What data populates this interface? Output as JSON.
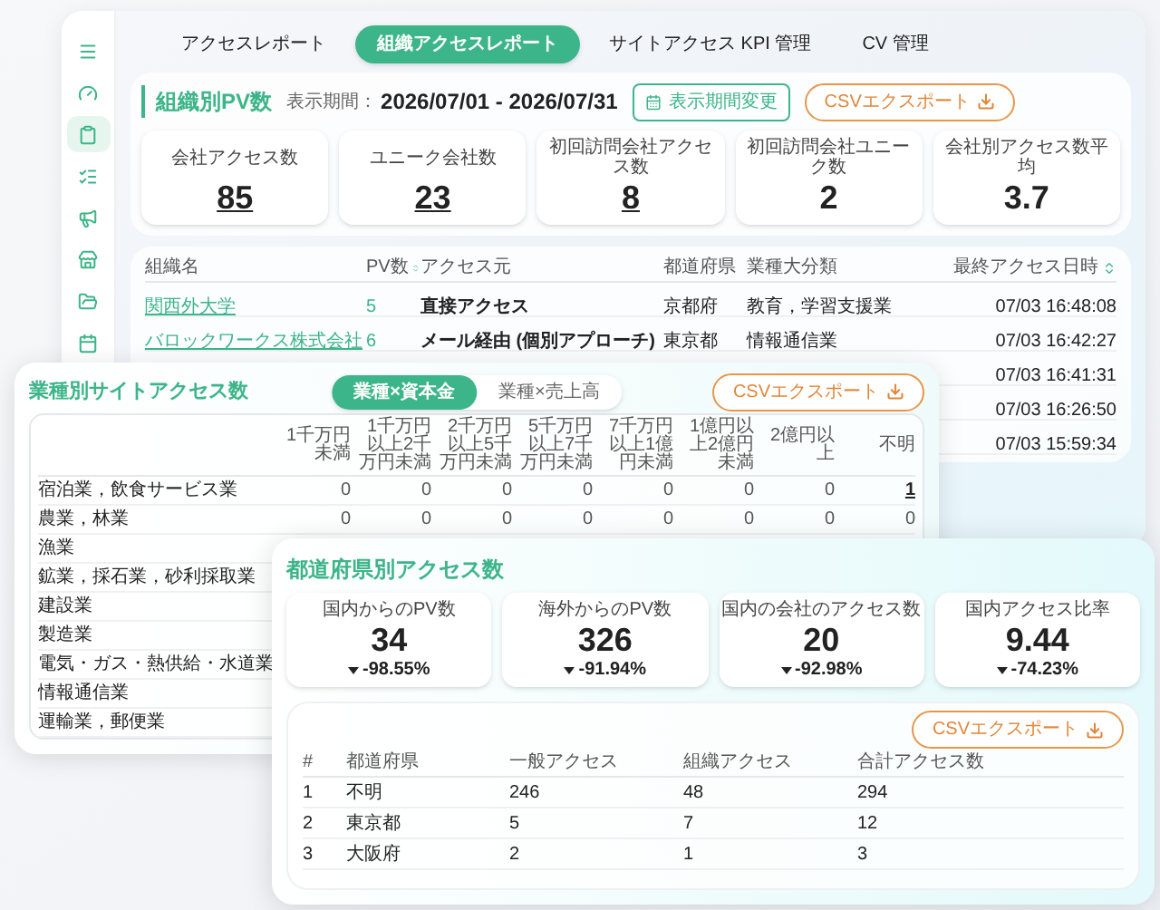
{
  "sidebar": {
    "items": [
      {
        "kind": "menu",
        "selected": false
      },
      {
        "kind": "gauge",
        "selected": false
      },
      {
        "kind": "clipboard",
        "selected": true
      },
      {
        "kind": "checklist",
        "selected": false
      },
      {
        "kind": "megaphone",
        "selected": false
      },
      {
        "kind": "store",
        "selected": false
      },
      {
        "kind": "folder",
        "selected": false
      },
      {
        "kind": "calendar",
        "selected": false
      }
    ]
  },
  "tabs": [
    {
      "label": "アクセスレポート",
      "selected": false
    },
    {
      "label": "組織アクセスレポート",
      "selected": true
    },
    {
      "label": "サイトアクセス KPI 管理",
      "selected": false
    },
    {
      "label": "CV 管理",
      "selected": false
    }
  ],
  "org_pv": {
    "title": "組織別PV数",
    "period_label": "表示期間：",
    "period": "2026/07/01 - 2026/07/31",
    "period_button": "表示期間変更",
    "export_button": "CSVエクスポート",
    "stats": [
      {
        "label": "会社アクセス数",
        "value": "85",
        "link": true
      },
      {
        "label": "ユニーク会社数",
        "value": "23",
        "link": true
      },
      {
        "label": "初回訪問会社アクセス数",
        "value": "8",
        "link": true
      },
      {
        "label": "初回訪問会社ユニーク数",
        "value": "2",
        "link": false
      },
      {
        "label": "会社別アクセス数平均",
        "value": "3.7",
        "link": false
      }
    ],
    "table": {
      "columns": [
        {
          "label": "組織名",
          "sortable": false
        },
        {
          "label": "PV数",
          "sortable": true
        },
        {
          "label": "アクセス元",
          "sortable": false
        },
        {
          "label": "都道府県",
          "sortable": false
        },
        {
          "label": "業種大分類",
          "sortable": false
        },
        {
          "label": "最終アクセス日時",
          "sortable": true
        }
      ],
      "rows": [
        {
          "name": "関西外大学",
          "pv": "5",
          "source": "直接アクセス",
          "prefecture": "京都府",
          "industry": "教育，学習支援業",
          "last_access": "07/03 16:48:08"
        },
        {
          "name": "バロックワークス株式会社",
          "pv": "6",
          "source": "メール経由 (個別アプローチ)",
          "prefecture": "東京都",
          "industry": "情報通信業",
          "last_access": "07/03 16:42:27"
        },
        {
          "last_access": "07/03 16:41:31"
        },
        {
          "last_access": "07/03 16:26:50"
        },
        {
          "last_access": "07/03 15:59:34"
        }
      ]
    }
  },
  "industry": {
    "title": "業種別サイトアクセス数",
    "toggle": [
      {
        "label": "業種×資本金",
        "selected": true
      },
      {
        "label": "業種×売上高",
        "selected": false
      }
    ],
    "export_button": "CSVエクスポート",
    "columns": [
      "1千万円未満",
      "1千万円以上2千万円未満",
      "2千万円以上5千万円未満",
      "5千万円以上7千万円未満",
      "7千万円以上1億円未満",
      "1億円以上2億円未満",
      "2億円以上",
      "不明"
    ],
    "rows": [
      {
        "label": "宿泊業，飲食サービス業",
        "values": [
          {
            "value": "0",
            "link": false
          },
          {
            "value": "0",
            "link": false
          },
          {
            "value": "0",
            "link": false
          },
          {
            "value": "0",
            "link": false
          },
          {
            "value": "0",
            "link": false
          },
          {
            "value": "0",
            "link": false
          },
          {
            "value": "0",
            "link": false
          },
          {
            "value": "1",
            "link": true
          }
        ]
      },
      {
        "label": "農業，林業",
        "values": [
          {
            "value": "0",
            "link": false
          },
          {
            "value": "0",
            "link": false
          },
          {
            "value": "0",
            "link": false
          },
          {
            "value": "0",
            "link": false
          },
          {
            "value": "0",
            "link": false
          },
          {
            "value": "0",
            "link": false
          },
          {
            "value": "0",
            "link": false
          },
          {
            "value": "0",
            "link": false
          }
        ]
      },
      {
        "label": "漁業",
        "values": []
      },
      {
        "label": "鉱業，採石業，砂利採取業",
        "values": []
      },
      {
        "label": "建設業",
        "values": []
      },
      {
        "label": "製造業",
        "values": []
      },
      {
        "label": "電気・ガス・熱供給・水道業",
        "values": []
      },
      {
        "label": "情報通信業",
        "values": []
      },
      {
        "label": "運輸業，郵便業",
        "values": []
      }
    ]
  },
  "prefecture": {
    "title": "都道府県別アクセス数",
    "stats": [
      {
        "label": "国内からのPV数",
        "value": "34",
        "change": "-98.55%"
      },
      {
        "label": "海外からのPV数",
        "value": "326",
        "change": "-91.94%"
      },
      {
        "label": "国内の会社のアクセス数",
        "value": "20",
        "change": "-92.98%"
      },
      {
        "label": "国内アクセス比率",
        "value": "9.44",
        "change": "-74.23%"
      }
    ],
    "export_button": "CSVエクスポート",
    "table": {
      "columns": [
        "#",
        "都道府県",
        "一般アクセス",
        "組織アクセス",
        "合計アクセス数"
      ],
      "rows": [
        [
          "1",
          "不明",
          "246",
          "48",
          "294"
        ],
        [
          "2",
          "東京都",
          "5",
          "7",
          "12"
        ],
        [
          "3",
          "大阪府",
          "2",
          "1",
          "3"
        ]
      ]
    }
  }
}
